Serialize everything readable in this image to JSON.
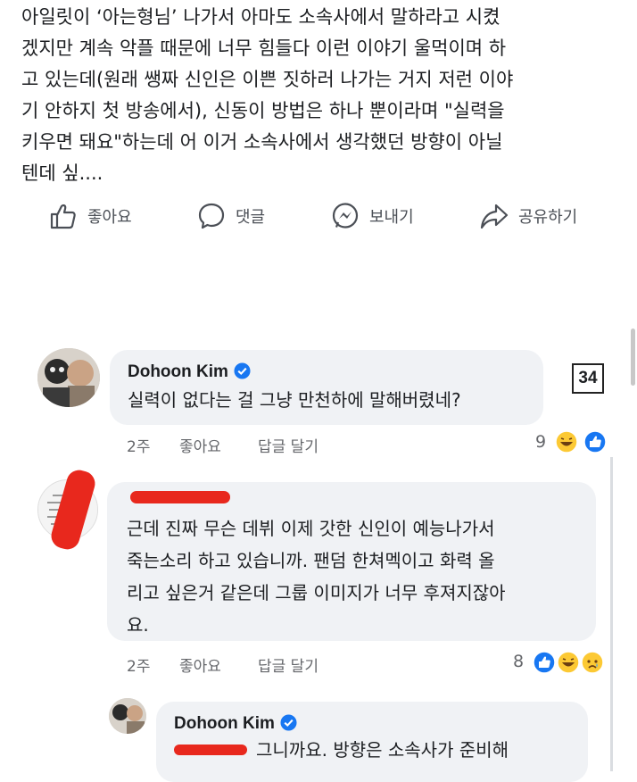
{
  "post": {
    "lines": [
      "아일릿이 ‘아는형님’ 나가서 아마도 소속사에서 말하라고 시켰",
      "겠지만 계속 악플 때문에 너무 힘들다 이런 이야기 울먹이며 하",
      "고 있는데(원래 쌩짜 신인은 이쁜 짓하러 나가는 거지 저런 이야",
      "기 안하지 첫 방송에서), 신동이 방법은 하나 뿐이라며 \"실력을",
      "키우면 돼요\"하는데 어 이거 소속사에서 생각했던 방향이 아닐",
      "텐데 싶...."
    ]
  },
  "actions": [
    {
      "label": "좋아요",
      "icon": "thumbs-up-icon"
    },
    {
      "label": "댓글",
      "icon": "comment-icon"
    },
    {
      "label": "보내기",
      "icon": "messenger-icon"
    },
    {
      "label": "공유하기",
      "icon": "share-icon"
    }
  ],
  "badge": "34",
  "comments": [
    {
      "name": "Dohoon Kim",
      "lines": [
        "실력이 없다는 걸 그냥 만천하에 말해버렸네?"
      ],
      "time": "2주",
      "like": "좋아요",
      "reply": "답글 달기",
      "reactions": "9"
    },
    {
      "name": "",
      "lines": [
        "근데 진짜 무슨 데뷔 이제 갓한 신인이 예능나가서",
        "죽는소리 하고 있습니까.  팬덤 한쳐멕이고 화력 올",
        "리고 싶은거 같은데 그룹 이미지가 너무 후져지잖아",
        "요."
      ],
      "time": "2주",
      "like": "좋아요",
      "reply": "답글 달기",
      "reactions": "8"
    },
    {
      "name": "Dohoon Kim",
      "lines": [
        "그니까요. 방향은 소속사가 준비해"
      ]
    }
  ],
  "colors": {
    "verified": "#1877f2",
    "like_blue": "#1877f2",
    "redaction": "#e8281d"
  }
}
